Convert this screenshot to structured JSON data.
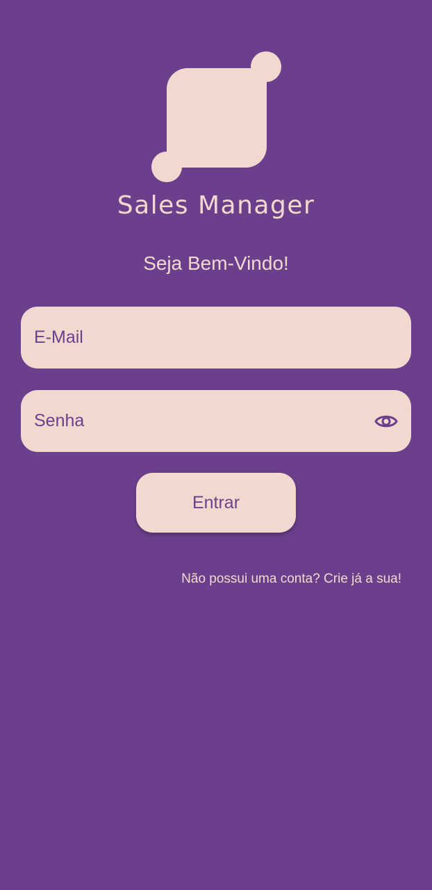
{
  "colors": {
    "background": "#6c3f8c",
    "accent_light": "#f2d9cf",
    "text_on_light": "#6c3f8c"
  },
  "logo": {
    "icon": "sales-manager-logo-icon"
  },
  "app": {
    "name": "Sales Manager"
  },
  "welcome": {
    "text": "Seja Bem-Vindo!"
  },
  "form": {
    "email": {
      "placeholder": "E-Mail",
      "value": ""
    },
    "password": {
      "placeholder": "Senha",
      "value": "",
      "toggle_icon": "eye-icon"
    },
    "submit_label": "Entrar"
  },
  "signup": {
    "text": "Não possui uma conta? Crie já a sua!"
  }
}
